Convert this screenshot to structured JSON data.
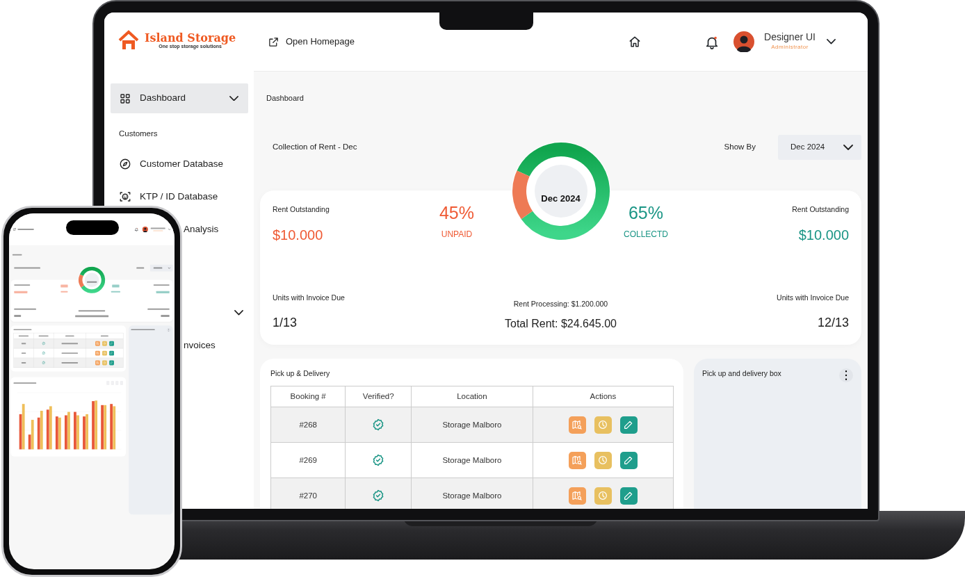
{
  "laptop": {
    "sidebar": {
      "logo": {
        "name": "Island Storage",
        "tagline": "One stop storage solutions"
      },
      "items": [
        {
          "kind": "item",
          "label": "Dashboard",
          "selected": true,
          "expandable": true
        },
        {
          "kind": "heading",
          "label": "Customers"
        },
        {
          "kind": "item",
          "label": "Customer Database",
          "selected": false,
          "expandable": false
        },
        {
          "kind": "item",
          "label": "KTP / ID Database",
          "selected": false,
          "expandable": false
        },
        {
          "kind": "partial",
          "label": "Analysis",
          "selected": false
        },
        {
          "kind": "group"
        },
        {
          "kind": "partial",
          "label": "nvoices",
          "selected": false
        }
      ]
    },
    "header": {
      "link": "Open Homepage",
      "unread": true,
      "user": {
        "name": "Designer UI",
        "role": "Administrator"
      }
    },
    "dashboard": {
      "breadcrumb": "Dashboard",
      "title": "Collection of Rent - Dec",
      "show_by": "Show By",
      "period": "Dec 2024",
      "donut_label": "Dec 2024",
      "stats": [
        {
          "label": "Rent Outstanding",
          "value": "$10.000",
          "color": "#ef5a34"
        },
        {
          "percent": "45%",
          "caption": "UNPAID",
          "color": "#ef5a34"
        },
        {
          "percent": "65%",
          "caption": "COLLECTD",
          "color": "#1a9585"
        },
        {
          "label": "Rent Outstanding",
          "value": "$10.000",
          "color": "#1a9585"
        }
      ],
      "units_left": {
        "label": "Units with Invoice Due",
        "value": "1/13"
      },
      "processing": "Rent Processing: $1.200.000",
      "total": "Total Rent: $24.645.00",
      "units_right": {
        "label": "Units with Invoice Due",
        "value": "12/13"
      }
    },
    "pickup": {
      "title": "Pick up & Delivery",
      "columns": [
        "Booking #",
        "Verified?",
        "Location",
        "Actions"
      ],
      "rows": [
        {
          "booking": "#268",
          "verified": true,
          "location": "Storage Malboro"
        },
        {
          "booking": "#269",
          "verified": true,
          "location": "Storage Malboro"
        },
        {
          "booking": "#270",
          "verified": true,
          "location": "Storage Malboro"
        }
      ]
    },
    "box": {
      "title": "Pick up and delivery box"
    }
  }
}
